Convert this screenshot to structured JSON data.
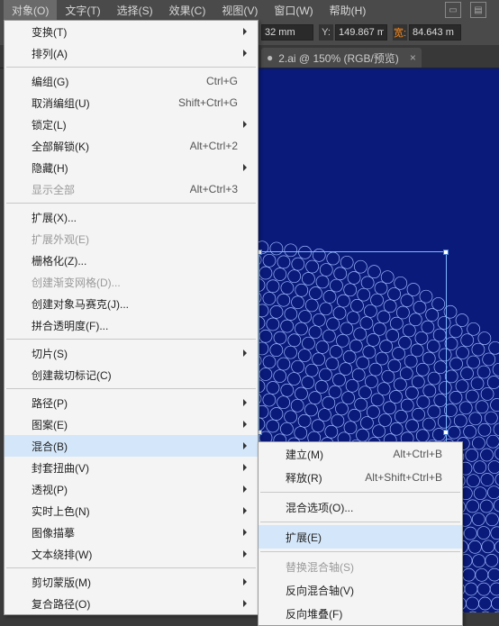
{
  "menubar": {
    "items": [
      {
        "label": "对象(O)",
        "active": true
      },
      {
        "label": "文字(T)"
      },
      {
        "label": "选择(S)"
      },
      {
        "label": "效果(C)"
      },
      {
        "label": "视图(V)"
      },
      {
        "label": "窗口(W)"
      },
      {
        "label": "帮助(H)"
      }
    ]
  },
  "props": {
    "x_unit": "32 mm",
    "y_label": "Y:",
    "y_value": "149.867 m",
    "w_label": "宽:",
    "w_value": "84.643 m"
  },
  "tab": {
    "bullet": "●",
    "label": "2.ai @ 150% (RGB/预览)",
    "close": "×"
  },
  "menu_object": [
    {
      "type": "item",
      "label": "变换(T)",
      "sub": true
    },
    {
      "type": "item",
      "label": "排列(A)",
      "sub": true
    },
    {
      "type": "sep"
    },
    {
      "type": "item",
      "label": "编组(G)",
      "shortcut": "Ctrl+G"
    },
    {
      "type": "item",
      "label": "取消编组(U)",
      "shortcut": "Shift+Ctrl+G"
    },
    {
      "type": "item",
      "label": "锁定(L)",
      "sub": true
    },
    {
      "type": "item",
      "label": "全部解锁(K)",
      "shortcut": "Alt+Ctrl+2"
    },
    {
      "type": "item",
      "label": "隐藏(H)",
      "sub": true
    },
    {
      "type": "item",
      "label": "显示全部",
      "shortcut": "Alt+Ctrl+3",
      "disabled": true
    },
    {
      "type": "sep"
    },
    {
      "type": "item",
      "label": "扩展(X)..."
    },
    {
      "type": "item",
      "label": "扩展外观(E)",
      "disabled": true
    },
    {
      "type": "item",
      "label": "栅格化(Z)..."
    },
    {
      "type": "item",
      "label": "创建渐变网格(D)...",
      "disabled": true
    },
    {
      "type": "item",
      "label": "创建对象马赛克(J)..."
    },
    {
      "type": "item",
      "label": "拼合透明度(F)..."
    },
    {
      "type": "sep"
    },
    {
      "type": "item",
      "label": "切片(S)",
      "sub": true
    },
    {
      "type": "item",
      "label": "创建裁切标记(C)"
    },
    {
      "type": "sep"
    },
    {
      "type": "item",
      "label": "路径(P)",
      "sub": true
    },
    {
      "type": "item",
      "label": "图案(E)",
      "sub": true
    },
    {
      "type": "item",
      "label": "混合(B)",
      "sub": true,
      "highlight": true
    },
    {
      "type": "item",
      "label": "封套扭曲(V)",
      "sub": true
    },
    {
      "type": "item",
      "label": "透视(P)",
      "sub": true
    },
    {
      "type": "item",
      "label": "实时上色(N)",
      "sub": true
    },
    {
      "type": "item",
      "label": "图像描摹",
      "sub": true
    },
    {
      "type": "item",
      "label": "文本绕排(W)",
      "sub": true
    },
    {
      "type": "sep"
    },
    {
      "type": "item",
      "label": "剪切蒙版(M)",
      "sub": true
    },
    {
      "type": "item",
      "label": "复合路径(O)",
      "sub": true
    }
  ],
  "menu_blend": [
    {
      "type": "item",
      "label": "建立(M)",
      "shortcut": "Alt+Ctrl+B"
    },
    {
      "type": "item",
      "label": "释放(R)",
      "shortcut": "Alt+Shift+Ctrl+B"
    },
    {
      "type": "sep"
    },
    {
      "type": "item",
      "label": "混合选项(O)..."
    },
    {
      "type": "sep"
    },
    {
      "type": "item",
      "label": "扩展(E)",
      "highlight": true
    },
    {
      "type": "sep"
    },
    {
      "type": "item",
      "label": "替换混合轴(S)",
      "disabled": true
    },
    {
      "type": "item",
      "label": "反向混合轴(V)"
    },
    {
      "type": "item",
      "label": "反向堆叠(F)"
    }
  ],
  "colors": {
    "menu_hl": "#d4e6f9",
    "canvas": "#0a1a7a"
  }
}
